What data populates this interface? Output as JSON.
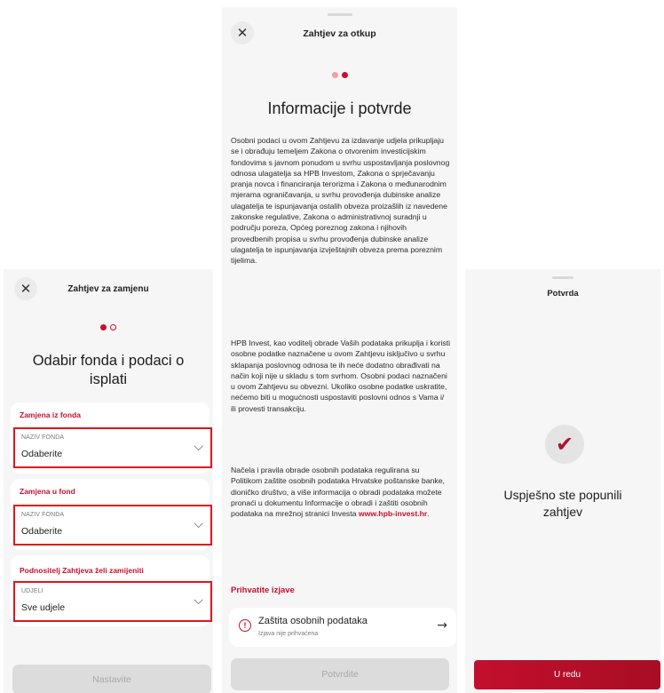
{
  "screen1": {
    "title": "Zahtjev za zamjenu",
    "close_glyph": "✕",
    "heading": "Odabir fonda i podaci o isplati",
    "sections": [
      {
        "label": "Zamjena iz fonda",
        "field_label": "NAZIV FONDA",
        "value": "Odaberite"
      },
      {
        "label": "Zamjena u fond",
        "field_label": "NAZIV FONDA",
        "value": "Odaberite"
      },
      {
        "label": "Podnositelj Zahtjeva želi zamijeniti",
        "field_label": "UDJELI",
        "value": "Sve udjele"
      }
    ],
    "chevron_glyph": "⌵",
    "continue_label": "Nastavite"
  },
  "screen2": {
    "title": "Zahtjev za otkup",
    "close_glyph": "✕",
    "heading": "Informacije i potvrde",
    "paragraph1": "Osobni podaci u ovom Zahtjevu za izdavanje udjela prikupljaju se i obrađuju temeljem Zakona o otvorenim investicijskim fondovima s javnom ponudom u svrhu uspostavljanja poslovnog odnosa ulagatelja sa HPB Investom, Zakona o sprječavanju pranja novca i financiranja terorizma i Zakona o međunarodnim mjerama ograničavanja, u svrhu provođenja dubinske analize ulagatelja te ispunjavanja ostalih obveza proizašlih iz navedene zakonske regulative, Zakona o administrativnoj suradnji u području poreza, Općeg poreznog zakona i njihovih provedbenih propisa u svrhu provođenja dubinske analize ulagatelja te ispunjavanja izvještajnih obveza prema poreznim tijelima.",
    "paragraph2": "HPB Invest, kao voditelj obrade Vaših podataka prikuplja i koristi osobne podatke naznačene u ovom Zahtjevu isključivo u svrhu sklapanja poslovnog odnosa te ih neće dodatno obrađivati na način koji nije u skladu s tom svrhom. Osobni podaci naznačeni u ovom Zahtjevu su obvezni. Ukoliko osobne podatke uskratite, nećemo biti u mogućnosti uspostaviti poslovni odnos s Vama i/ ili provesti transakciju.",
    "paragraph3": "Načela i pravila obrade osobnih podataka regulirana su Politikom zaštite osobnih podataka Hrvatske poštanske banke, dioničko društvo, a više informacija o obradi podataka možete pronaći u dokumentu Informacije o obradi i zaštiti osobnih podataka na mrežnoj stranici Investa",
    "link": "www.hpb-invest.hr",
    "link_suffix": ".",
    "accept_title": "Prihvatite izjave",
    "declaration_title": "Zaštita osobnih podataka",
    "declaration_status": "Izjava nije prihvaćena",
    "warn_glyph": "!",
    "arrow_glyph": "→",
    "confirm_label": "Potvrdite"
  },
  "screen3": {
    "title": "Potvrda",
    "check_glyph": "✔",
    "success_line1": "Uspješno ste popunili",
    "success_line2": "zahtjev",
    "ok_label": "U redu"
  },
  "colors": {
    "brand_red": "#c8102e",
    "highlight_border": "#e3131f",
    "disabled_button": "#dcdcdc"
  }
}
